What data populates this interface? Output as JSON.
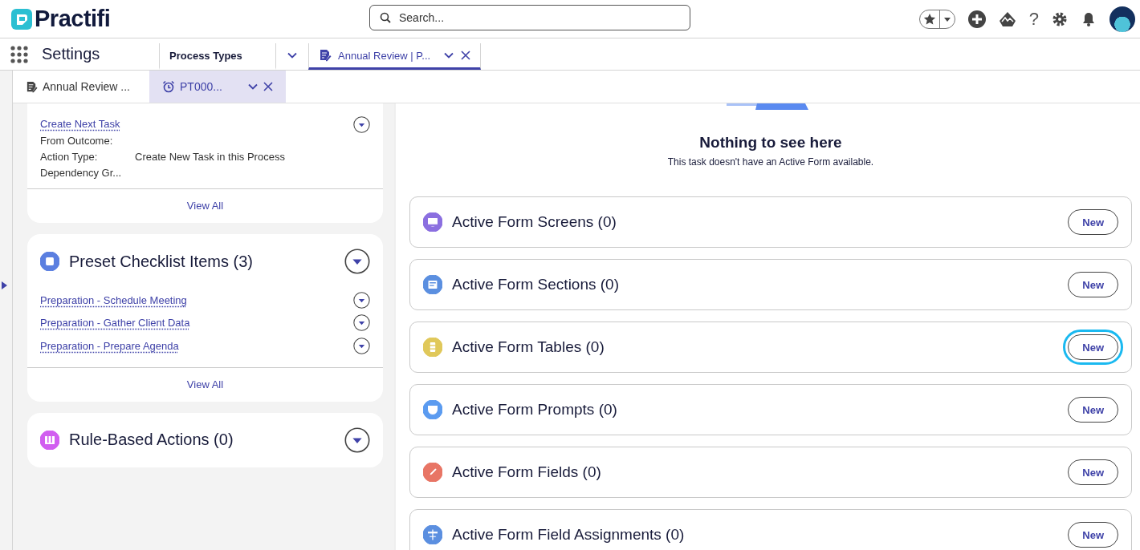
{
  "header": {
    "logo_text": "Practifi",
    "search": {
      "placeholder": "Search..."
    },
    "help_glyph": "?"
  },
  "nav": {
    "app_name": "Settings",
    "tabs": [
      {
        "label": "Process Types",
        "selected": false
      },
      {
        "label": "Annual Review | P...",
        "selected": true
      }
    ]
  },
  "subtabs": [
    {
      "label": "Annual Review ...",
      "selected": false
    },
    {
      "label": "PT000...",
      "selected": true
    }
  ],
  "left_cards": [
    {
      "kind": "actions",
      "items": [
        {
          "link": "Create Next Task",
          "fields": [
            {
              "label": "From Outcome:"
            },
            {
              "label": "Action Type:",
              "value": "Create New Task in this Process"
            },
            {
              "label": "Dependency Gr..."
            }
          ]
        }
      ],
      "footer": "View All"
    },
    {
      "kind": "list",
      "title": "Preset Checklist Items (3)",
      "color": "#5b7fe0",
      "items": [
        {
          "link": "Preparation - Schedule Meeting"
        },
        {
          "link": "Preparation - Gather Client Data"
        },
        {
          "link": "Preparation - Prepare Agenda"
        }
      ],
      "footer": "View All"
    },
    {
      "kind": "header",
      "title": "Rule-Based Actions (0)",
      "color": "#d15ef0"
    }
  ],
  "empty_state": {
    "title": "Nothing to see here",
    "message": "This task doesn't have an Active Form available."
  },
  "related_lists": [
    {
      "title": "Active Form Screens (0)",
      "button": "New",
      "color": "#8b6fe0",
      "focused": false
    },
    {
      "title": "Active Form Sections (0)",
      "button": "New",
      "color": "#5b8fe0",
      "focused": false
    },
    {
      "title": "Active Form Tables (0)",
      "button": "New",
      "color": "#e0c85a",
      "focused": true
    },
    {
      "title": "Active Form Prompts (0)",
      "button": "New",
      "color": "#5b9bf0",
      "focused": false
    },
    {
      "title": "Active Form Fields (0)",
      "button": "New",
      "color": "#e87565",
      "focused": false
    },
    {
      "title": "Active Form Field Assignments (0)",
      "button": "New",
      "color": "#5b8fe0",
      "focused": false
    }
  ]
}
